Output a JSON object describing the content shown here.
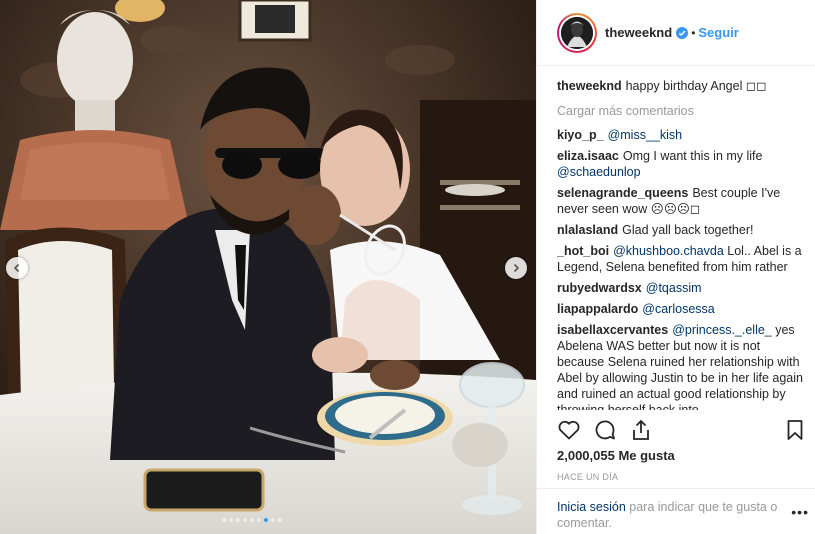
{
  "post": {
    "username": "theweeknd",
    "verified_icon": "verified-badge-icon",
    "separator": "•",
    "follow_label": "Seguir"
  },
  "caption": {
    "username": "theweeknd",
    "text": "happy birthday Angel ◻◻"
  },
  "load_more_label": "Cargar más comentarios",
  "comments": [
    {
      "user": "kiyo_p_",
      "mention": "@miss__kish",
      "text": ""
    },
    {
      "user": "eliza.isaac",
      "mention": "",
      "text": "Omg I want this in my life",
      "mention_after": "@schaedunlop"
    },
    {
      "user": "selenagrande_queens",
      "mention": "",
      "text": "Best couple I've never seen wow ☹☹☹◻"
    },
    {
      "user": "nlalasland",
      "mention": "",
      "text": "Glad yall back together!"
    },
    {
      "user": "_hot_boi",
      "mention": "@khushboo.chavda",
      "text": "Lol.. Abel is a Legend, Selena benefited from him rather"
    },
    {
      "user": "rubyedwardsx",
      "mention": "@tqassim",
      "text": ""
    },
    {
      "user": "liapappalardo",
      "mention": "@carlosessa",
      "text": ""
    },
    {
      "user": "isabellaxcervantes",
      "mention": "@princess._.elle_",
      "text": "yes Abelena WAS better but now it is not because Selena ruined her relationship with Abel by allowing Justin to be in her life again and ruined an actual good relationship by throwing herself back into"
    }
  ],
  "likes": "2,000,055 Me gusta",
  "time": "HACE UN DÍA",
  "login": {
    "link": "Inicia sesión",
    "text": "para indicar que te gusta o comentar."
  },
  "more_label": "•••",
  "carousel": {
    "dot_count": 9,
    "active_index": 6,
    "accent_color": "#3897f0"
  },
  "icons": {
    "like": "heart-icon",
    "comment": "comment-icon",
    "share": "share-icon",
    "save": "bookmark-icon",
    "prev": "chevron-left-icon",
    "next": "chevron-right-icon"
  }
}
